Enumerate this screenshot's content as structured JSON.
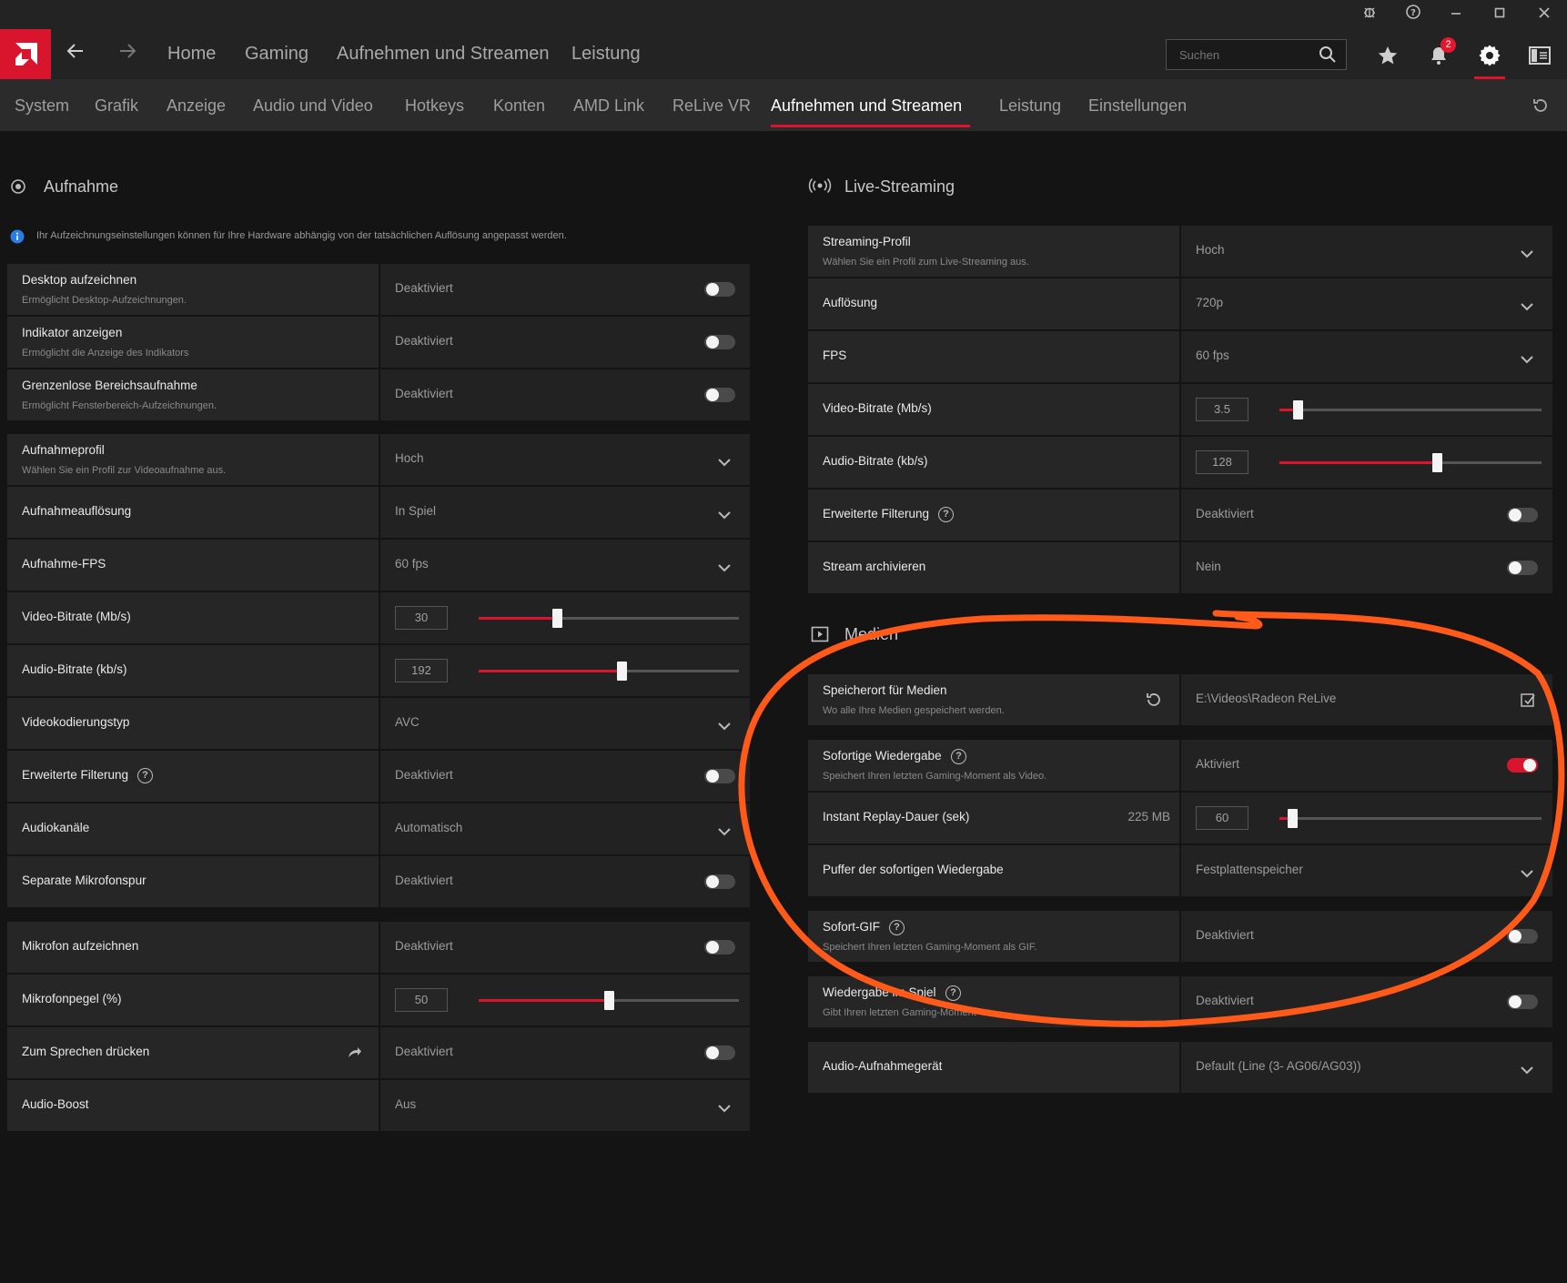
{
  "topbar": {
    "nav": [
      "Home",
      "Gaming",
      "Aufnehmen und Streamen",
      "Leistung"
    ],
    "search_placeholder": "Suchen",
    "notification_count": "2"
  },
  "subnav": {
    "items": [
      "System",
      "Grafik",
      "Anzeige",
      "Audio und Video",
      "Hotkeys",
      "Konten",
      "AMD Link",
      "ReLive VR",
      "Aufnehmen und Streamen",
      "Leistung",
      "Einstellungen"
    ],
    "active": "Aufnehmen und Streamen"
  },
  "recording": {
    "title": "Aufnahme",
    "info": "Ihr Aufzeichnungseinstellungen können für Ihre Hardware abhängig von der tatsächlichen Auflösung angepasst werden.",
    "rows": [
      {
        "label": "Desktop aufzeichnen",
        "sub": "Ermöglicht Desktop-Aufzeichnungen.",
        "value": "Deaktiviert"
      },
      {
        "label": "Indikator anzeigen",
        "sub": "Ermöglicht die Anzeige des Indikators",
        "value": "Deaktiviert"
      },
      {
        "label": "Grenzenlose Bereichsaufnahme",
        "sub": "Ermöglicht Fensterbereich-Aufzeichnungen.",
        "value": "Deaktiviert"
      },
      {
        "label": "Aufnahmeprofil",
        "sub": "Wählen Sie ein Profil zur Videoaufnahme aus.",
        "value": "Hoch"
      },
      {
        "label": "Aufnahmeauflösung",
        "value": "In Spiel"
      },
      {
        "label": "Aufnahme-FPS",
        "value": "60 fps"
      },
      {
        "label": "Video-Bitrate (Mb/s)",
        "value": "30",
        "level": 0.3
      },
      {
        "label": "Audio-Bitrate (kb/s)",
        "value": "192",
        "level": 0.55
      },
      {
        "label": "Videokodierungstyp",
        "value": "AVC"
      },
      {
        "label": "Erweiterte Filterung",
        "value": "Deaktiviert"
      },
      {
        "label": "Audiokanäle",
        "value": "Automatisch"
      },
      {
        "label": "Separate Mikrofonspur",
        "value": "Deaktiviert"
      },
      {
        "label": "Mikrofon aufzeichnen",
        "value": "Deaktiviert"
      },
      {
        "label": "Mikrofonpegel (%)",
        "value": "50",
        "level": 0.5
      },
      {
        "label": "Zum Sprechen drücken",
        "value": "Deaktiviert"
      },
      {
        "label": "Audio-Boost",
        "value": "Aus"
      }
    ]
  },
  "streaming": {
    "title": "Live-Streaming",
    "rows": [
      {
        "label": "Streaming-Profil",
        "sub": "Wählen Sie ein Profil zum Live-Streaming aus.",
        "value": "Hoch"
      },
      {
        "label": "Auflösung",
        "value": "720p"
      },
      {
        "label": "FPS",
        "value": "60 fps"
      },
      {
        "label": "Video-Bitrate (Mb/s)",
        "value": "3.5",
        "level": 0.07
      },
      {
        "label": "Audio-Bitrate (kb/s)",
        "value": "128",
        "level": 0.6
      },
      {
        "label": "Erweiterte Filterung",
        "value": "Deaktiviert"
      },
      {
        "label": "Stream archivieren",
        "value": "Nein"
      }
    ]
  },
  "media": {
    "title": "Medien",
    "rows": [
      {
        "label": "Speicherort für Medien",
        "sub": "Wo alle Ihre Medien gespeichert werden.",
        "value": "E:\\Videos\\Radeon ReLive"
      },
      {
        "label": "Sofortige Wiedergabe",
        "sub": "Speichert Ihren letzten Gaming-Moment als Video.",
        "value": "Aktiviert"
      },
      {
        "label": "Instant Replay-Dauer (sek)",
        "extra": "225 MB",
        "value": "60",
        "level": 0.05
      },
      {
        "label": "Puffer der sofortigen Wiedergabe",
        "value": "Festplattenspeicher"
      },
      {
        "label": "Sofort-GIF",
        "sub": "Speichert Ihren letzten Gaming-Moment als GIF.",
        "value": "Deaktiviert"
      },
      {
        "label": "Wiedergabe im Spiel",
        "sub": "Gibt Ihren letzten Gaming-Moment",
        "value": "Deaktiviert"
      },
      {
        "label": "Audio-Aufnahmegerät",
        "value": "Default (Line (3- AG06/AG03))"
      }
    ]
  },
  "colors": {
    "accent": "#d8152c",
    "annotation": "#ff5a1a"
  }
}
